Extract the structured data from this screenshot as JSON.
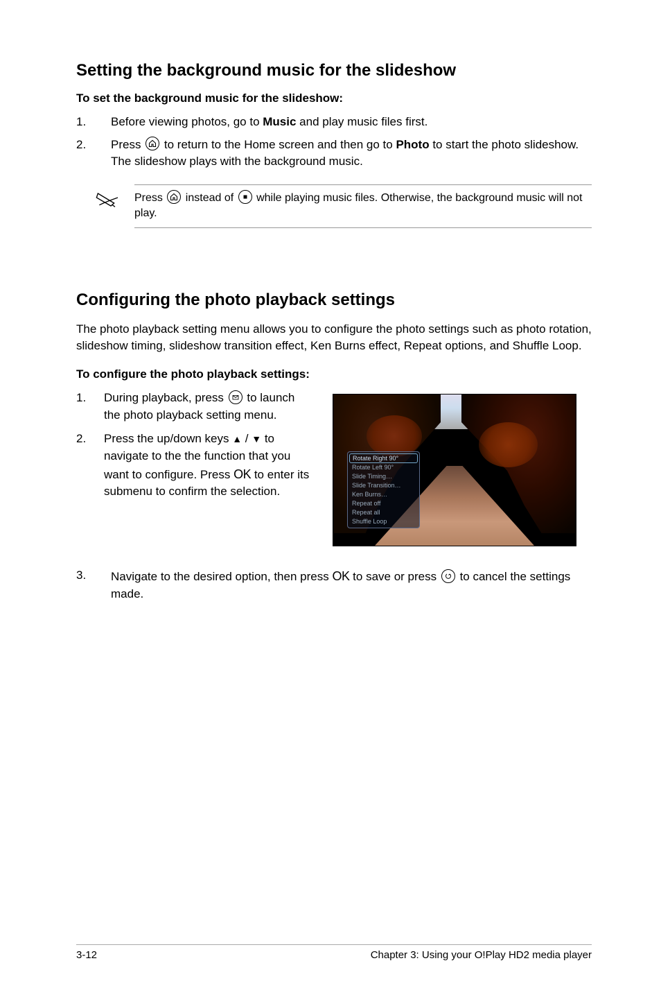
{
  "section1": {
    "heading": "Setting the background music for the slideshow",
    "subheading": "To set the background music for the slideshow:",
    "step1_num": "1.",
    "step1_pre": "Before viewing photos, go to ",
    "step1_bold": "Music",
    "step1_post": " and play music files first.",
    "step2_num": "2.",
    "step2_pre": "Press ",
    "step2_mid": " to return to the Home screen and then go to ",
    "step2_bold": "Photo",
    "step2_post": " to start the photo slideshow. The slideshow plays with the background music.",
    "note_pre": "Press ",
    "note_mid": " instead of ",
    "note_post": " while playing music files. Otherwise, the background music will not play."
  },
  "section2": {
    "heading": "Configuring the photo playback settings",
    "intro": "The photo playback setting menu allows you to configure the photo settings such as photo rotation, slideshow timing, slideshow transition effect, Ken Burns effect, Repeat options, and Shuffle Loop.",
    "subheading": "To configure the photo playback settings:",
    "step1_num": "1.",
    "step1_pre": "During playback, press ",
    "step1_post": " to launch the photo playback setting menu.",
    "step2_num": "2.",
    "step2_pre": "Press the up/down keys ",
    "step2_mid": " to navigate to the the function that you want to configure. Press ",
    "step2_post": " to enter its submenu to confirm the selection.",
    "step3_num": "3.",
    "step3_pre": "Navigate to the desired option, then press ",
    "step3_mid": " to save or press ",
    "step3_post": " to cancel the settings made.",
    "menu": {
      "items": [
        "Rotate Right 90°",
        "Rotate Left 90°",
        "Slide Timing…",
        "Slide Transition…",
        "Ken Burns…",
        "Repeat off",
        "Repeat all",
        "Shuffle Loop"
      ]
    }
  },
  "icons": {
    "home": "home-icon",
    "stop": "stop-icon",
    "envelope": "option-icon",
    "back": "back-icon"
  },
  "glyphs": {
    "slash": " / ",
    "ok": "OK",
    "up": "▲",
    "down": "▼"
  },
  "footer": {
    "page": "3-12",
    "chapter": "Chapter 3: Using your O!Play HD2 media player"
  }
}
